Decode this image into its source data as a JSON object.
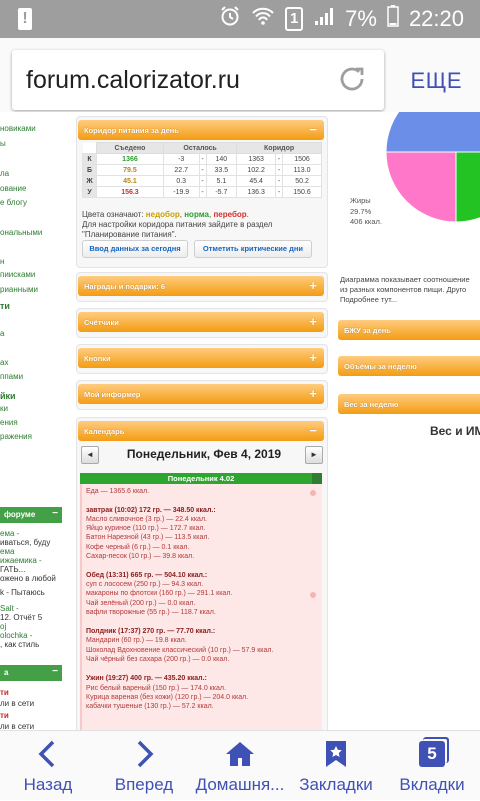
{
  "status_bar": {
    "time": "22:20",
    "battery": "7%",
    "sim": "1",
    "notification": "!"
  },
  "browser": {
    "url": "forum.calorizator.ru",
    "menu_label": "ЕЩЕ"
  },
  "left_column": {
    "items": [
      "новиками",
      "ы",
      "ла",
      "ование",
      "е блогу",
      "ональными",
      "н",
      "пиисками",
      "рианными",
      "ти",
      "а",
      "ах",
      "ппами",
      "йки",
      "ки",
      "ения",
      "ражения"
    ],
    "forum_header": "форуме",
    "forum_posts": [
      "ема -",
      "иваться, буду",
      "ема",
      "ижаемика -",
      "ГАТЬ...",
      "ожено в любой",
      "k - Пытаюсь",
      "Salt -",
      "12. Отчёт 5",
      "oj",
      "olochka -",
      ", как стиль"
    ],
    "section2_header": "а",
    "tail": [
      "ти",
      "ли в сети",
      "ти",
      "ли в сети"
    ]
  },
  "mid": {
    "corridor_title": "Коридор питания за день",
    "table_headers": [
      "Съедено",
      "Осталось",
      "Коридор"
    ],
    "rows": [
      {
        "label": "К",
        "eaten": "1366",
        "rem_a": "-3",
        "rem_b": "140",
        "c_lo": "1363",
        "c_hi": "1506"
      },
      {
        "label": "Б",
        "eaten": "79.5",
        "rem_a": "22.7",
        "rem_b": "33.5",
        "c_lo": "102.2",
        "c_hi": "113.0"
      },
      {
        "label": "Ж",
        "eaten": "45.1",
        "rem_a": "0.3",
        "rem_b": "5.1",
        "c_lo": "45.4",
        "c_hi": "50.2"
      },
      {
        "label": "У",
        "eaten": "156.3",
        "rem_a": "-19.9",
        "rem_b": "-5.7",
        "c_lo": "136.3",
        "c_hi": "150.6"
      }
    ],
    "colors_prefix": "Цвета означают:",
    "color_under": "недобор",
    "color_norm": "норма",
    "color_over": "перебор",
    "note_line1": "Для настройки коридора питания зайдите в раздел",
    "note_line2": "\"Планирование питания\".",
    "btn_enter": "Ввод данных за сегодня",
    "btn_critical": "Отметить критические дни",
    "panels": [
      "Награды и подарки: 6",
      "Счётчики",
      "Кнопки",
      "Мой информер",
      "Календарь"
    ],
    "calendar_date": "Понедельник, Фев 4, 2019",
    "day_bar": "Понедельник 4.02",
    "food_total": "Еда — 1365.6 ккал.",
    "meals": [
      {
        "title": "завтрак (10:02) 172 гр. — 348.50 ккал.:",
        "items": [
          "Масло сливочное (3 гр.) — 22.4 ккал.",
          "Яйцо куриное (110 гр.) — 172.7 ккал.",
          "Батон Нарезной (43 гр.) — 113.5 ккал.",
          "Кофе черный (6 гр.) — 0.1 ккал.",
          "Сахар-песок (10 гр.) — 39.8 ккал."
        ]
      },
      {
        "title": "Обед (13:31) 665 гр. — 504.10 ккал.:",
        "items": [
          "суп с лососем (250 гр.) — 94.3 ккал.",
          "макароны по флотски (160 гр.) — 291.1 ккал.",
          "Чай зелёный (200 гр.) — 0.0 ккал.",
          "вафли творожные (55 гр.) — 118.7 ккал."
        ]
      },
      {
        "title": "Полдник (17:37) 270 гр. — 77.70 ккал.:",
        "items": [
          "Мандарин (60 гр.) — 19.8 ккал.",
          "Шоколад Вдохновение классический (10 гр.) — 57.9 ккал.",
          "Чай чёрный без сахара (200 гр.) — 0.0 ккал."
        ]
      },
      {
        "title": "Ужин (19:27) 400 гр. — 435.20 ккал.:",
        "items": [
          "Рис белый вареный (150 гр.) — 174.0 ккал.",
          "Курица вареная (без кожи) (120 гр.) — 204.0 ккал.",
          "кабачки тушеные (130 гр.) — 57.2 ккал."
        ]
      }
    ]
  },
  "right": {
    "legend_label": "Жиры",
    "legend_pct": "29.7%",
    "legend_kcal": "406 ккал.",
    "desc_line1": "Диаграмма показывает соотношение",
    "desc_line2": "из разных компонентов пищи. Друго",
    "desc_line3": "Подробнее тут...",
    "panels": [
      "БЖУ за день",
      "Объёмы за неделю",
      "Вес за неделю"
    ],
    "weight_title": "Вес и ИМ"
  },
  "pie": {
    "colors": [
      "#6b8ee8",
      "#ff77c8",
      "#22c322"
    ]
  },
  "bottom_nav": [
    "Назад",
    "Вперед",
    "Домашня...",
    "Закладки",
    "Вкладки"
  ],
  "tabs_count": "5"
}
